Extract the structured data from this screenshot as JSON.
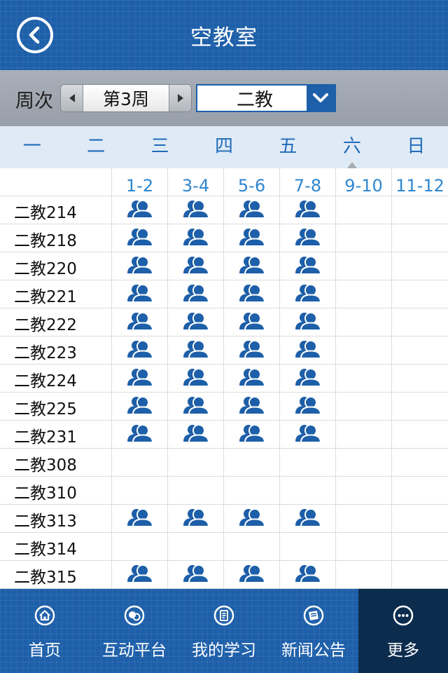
{
  "header": {
    "title": "空教室"
  },
  "filter": {
    "week_label": "周次",
    "week_value": "第3周",
    "building_value": "二教"
  },
  "days": [
    "一",
    "二",
    "三",
    "四",
    "五",
    "六",
    "日"
  ],
  "active_day_index": 5,
  "periods": [
    "1-2",
    "3-4",
    "5-6",
    "7-8",
    "9-10",
    "11-12"
  ],
  "rooms": [
    {
      "name": "二教214",
      "available": [
        true,
        true,
        true,
        true,
        false,
        false
      ]
    },
    {
      "name": "二教218",
      "available": [
        true,
        true,
        true,
        true,
        false,
        false
      ]
    },
    {
      "name": "二教220",
      "available": [
        true,
        true,
        true,
        true,
        false,
        false
      ]
    },
    {
      "name": "二教221",
      "available": [
        true,
        true,
        true,
        true,
        false,
        false
      ]
    },
    {
      "name": "二教222",
      "available": [
        true,
        true,
        true,
        true,
        false,
        false
      ]
    },
    {
      "name": "二教223",
      "available": [
        true,
        true,
        true,
        true,
        false,
        false
      ]
    },
    {
      "name": "二教224",
      "available": [
        true,
        true,
        true,
        true,
        false,
        false
      ]
    },
    {
      "name": "二教225",
      "available": [
        true,
        true,
        true,
        true,
        false,
        false
      ]
    },
    {
      "name": "二教231",
      "available": [
        true,
        true,
        true,
        true,
        false,
        false
      ]
    },
    {
      "name": "二教308",
      "available": [
        false,
        false,
        false,
        false,
        false,
        false
      ]
    },
    {
      "name": "二教310",
      "available": [
        false,
        false,
        false,
        false,
        false,
        false
      ]
    },
    {
      "name": "二教313",
      "available": [
        true,
        true,
        true,
        true,
        false,
        false
      ]
    },
    {
      "name": "二教314",
      "available": [
        false,
        false,
        false,
        false,
        false,
        false
      ]
    },
    {
      "name": "二教315",
      "available": [
        true,
        true,
        true,
        true,
        false,
        false
      ]
    }
  ],
  "tabbar": [
    {
      "label": "首页",
      "icon": "home-icon"
    },
    {
      "label": "互动平台",
      "icon": "chat-icon"
    },
    {
      "label": "我的学习",
      "icon": "notebook-icon"
    },
    {
      "label": "新闻公告",
      "icon": "newspaper-icon"
    },
    {
      "label": "更多",
      "icon": "more-icon"
    }
  ],
  "active_tab_index": 4,
  "colors": {
    "brand_blue": "#1d5fa9",
    "period_text": "#2f86cf",
    "day_tab_bg": "#dfeaf7",
    "active_tab_bg": "#0c2c4e"
  }
}
